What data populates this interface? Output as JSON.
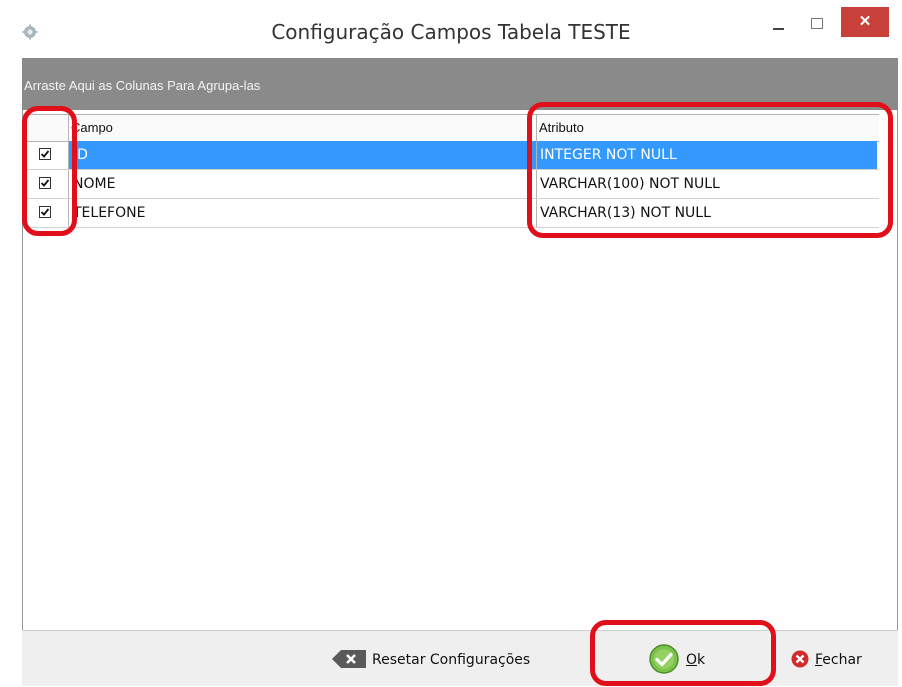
{
  "window": {
    "title": "Configuração Campos Tabela TESTE",
    "close_glyph": "✕"
  },
  "group_panel": {
    "text": "Arraste Aqui as Colunas Para Agrupa-las"
  },
  "grid": {
    "columns": [
      "Campo",
      "Atributo"
    ],
    "rows": [
      {
        "checked": true,
        "campo": "ID",
        "atributo": "INTEGER NOT NULL",
        "selected": true
      },
      {
        "checked": true,
        "campo": "NOME",
        "atributo": "VARCHAR(100) NOT NULL",
        "selected": false
      },
      {
        "checked": true,
        "campo": "TELEFONE",
        "atributo": "VARCHAR(13) NOT NULL",
        "selected": false
      }
    ]
  },
  "footer": {
    "reset_label": "Resetar Configurações",
    "ok_label": "Ok",
    "close_label": "Fechar"
  },
  "colors": {
    "selection": "#3399ff",
    "close_button": "#c7403a",
    "annotation": "#e10f1a",
    "group_panel": "#8a8a8a"
  },
  "icons": {
    "app": "gear-icon",
    "reset": "clear-icon",
    "ok": "check-circle-icon",
    "close": "close-circle-icon"
  }
}
